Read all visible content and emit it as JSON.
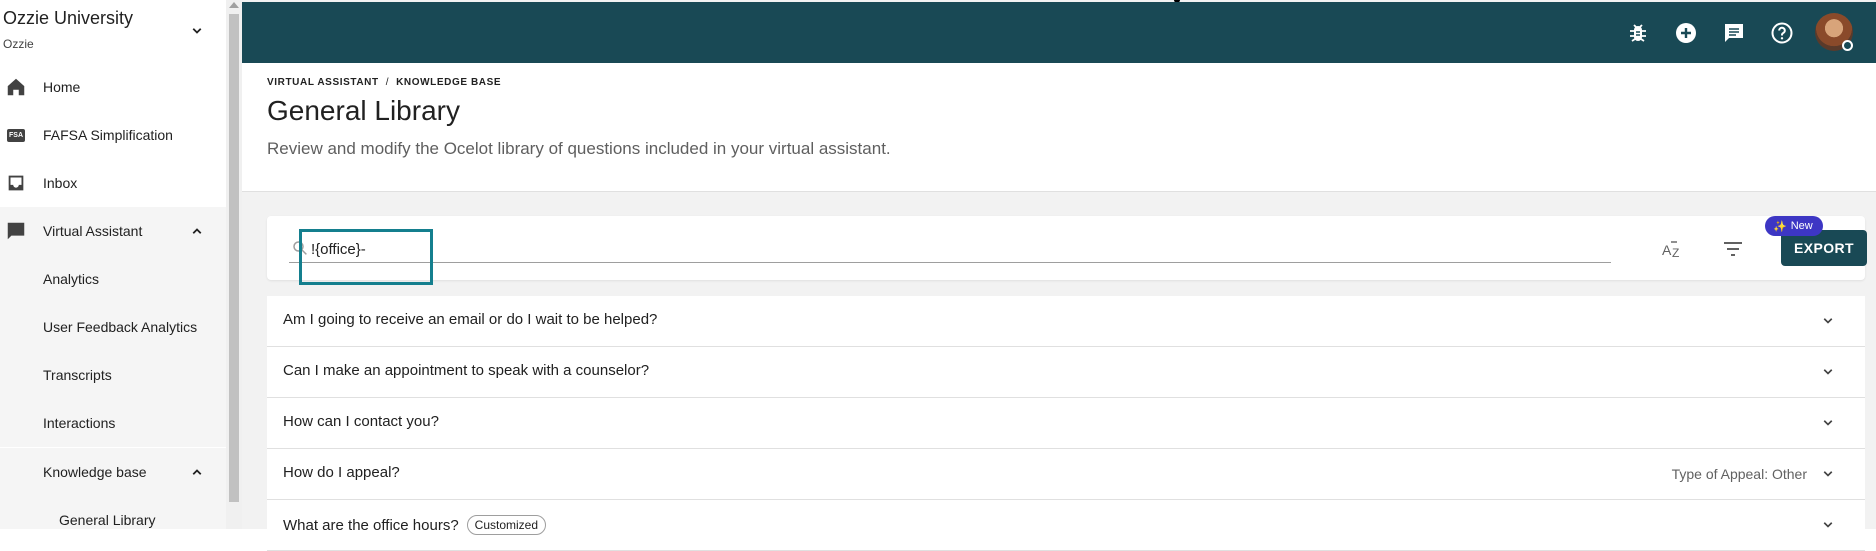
{
  "sidebar": {
    "org_name": "Ozzie University",
    "org_sub": "Ozzie",
    "items": [
      {
        "label": "Home",
        "icon": "home-icon"
      },
      {
        "label": "FAFSA Simplification",
        "icon": "fsa-icon",
        "icon_text": "FSA"
      },
      {
        "label": "Inbox",
        "icon": "inbox-icon"
      },
      {
        "label": "Virtual Assistant",
        "icon": "chat-bubble-icon",
        "expanded": true
      },
      {
        "label": "Analytics"
      },
      {
        "label": "User Feedback Analytics"
      },
      {
        "label": "Transcripts"
      },
      {
        "label": "Interactions"
      },
      {
        "label": "Knowledge base",
        "expanded": true
      },
      {
        "label": "General Library"
      }
    ]
  },
  "topbar": {
    "color": "#194955",
    "icons": [
      "bug-icon",
      "add-circle-icon",
      "message-icon",
      "help-icon"
    ]
  },
  "header": {
    "breadcrumb": [
      "VIRTUAL ASSISTANT",
      "KNOWLEDGE BASE"
    ],
    "breadcrumb_sep": "/",
    "title": "General Library",
    "description": "Review and modify the Ocelot library of questions included in your virtual assistant."
  },
  "search": {
    "value": "!{office}-",
    "highlight_color": "#147f8e"
  },
  "toolbar": {
    "export_label": "EXPORT",
    "new_badge": "New",
    "new_badge_icon": "✨"
  },
  "questions": [
    {
      "text": "Am I going to receive an email or do I wait to be helped?"
    },
    {
      "text": "Can I make an appointment to speak with a counselor?"
    },
    {
      "text": "How can I contact you?"
    },
    {
      "text": "How do I appeal?",
      "tag": "Type of Appeal: Other"
    },
    {
      "text": "What are the office hours?",
      "chip": "Customized"
    }
  ]
}
